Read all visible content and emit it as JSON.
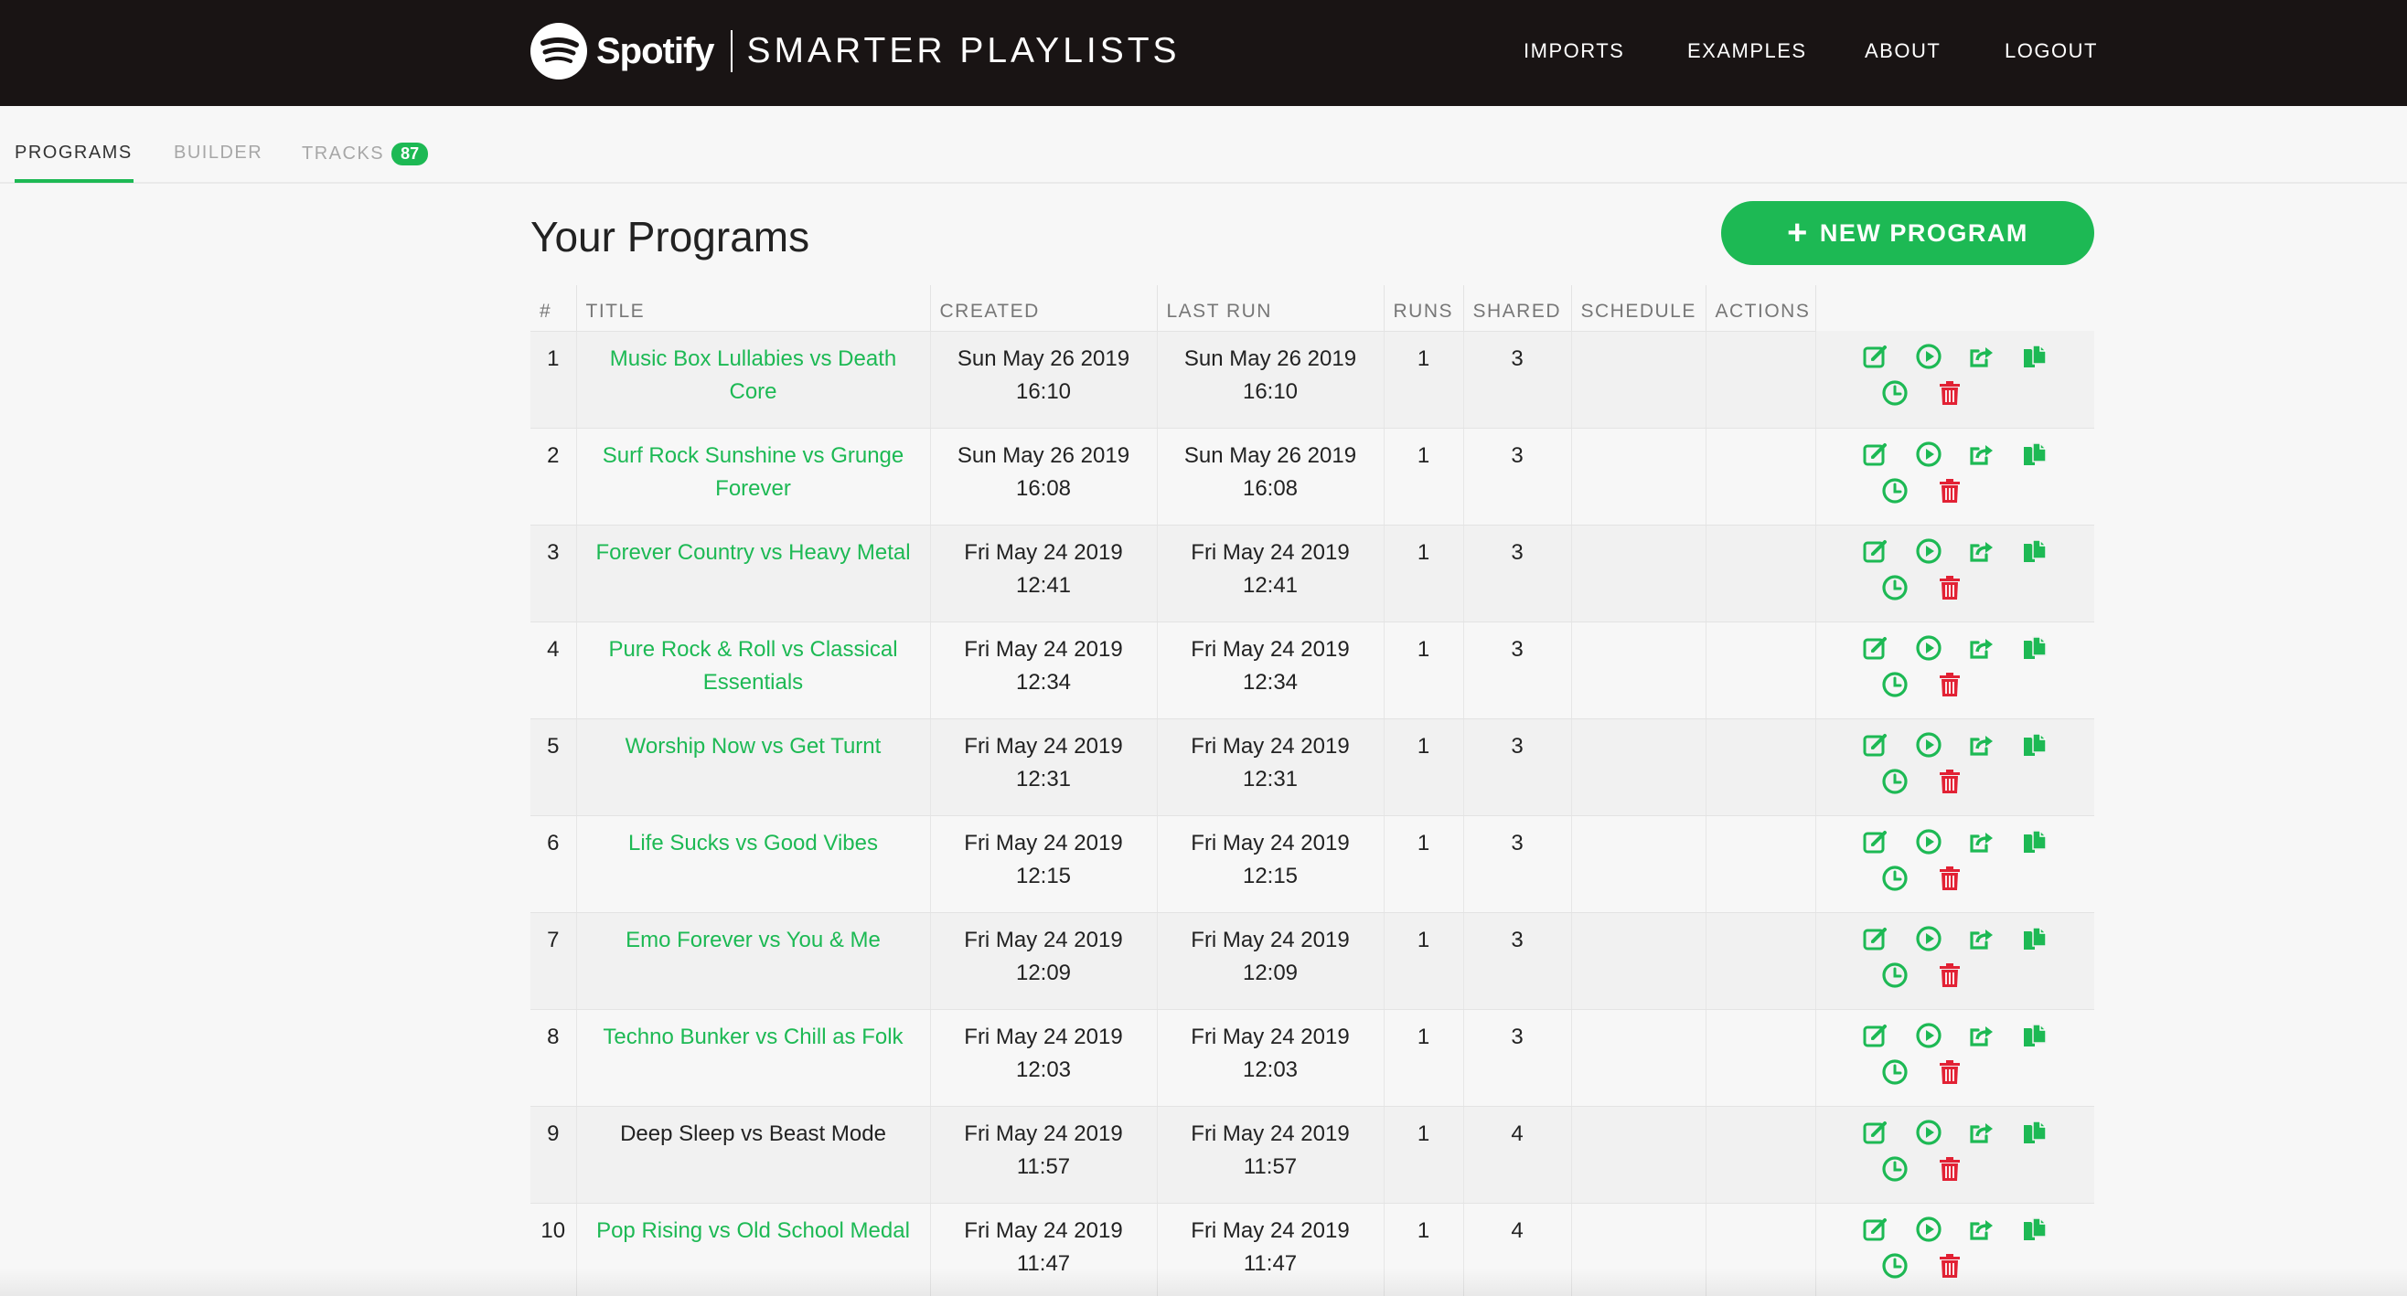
{
  "brand": {
    "spotify_wordmark": "Spotify",
    "subtitle": "SMARTER PLAYLISTS"
  },
  "nav": {
    "imports": "IMPORTS",
    "examples": "EXAMPLES",
    "about": "ABOUT",
    "logout": "LOGOUT"
  },
  "tabs": {
    "programs": "PROGRAMS",
    "builder": "BUILDER",
    "tracks": "TRACKS",
    "tracks_count": "87"
  },
  "main": {
    "title": "Your Programs",
    "new_program_label": "NEW PROGRAM",
    "new_program_icon": "plus-icon"
  },
  "table": {
    "headers": [
      "#",
      "TITLE",
      "CREATED",
      "LAST RUN",
      "RUNS",
      "SHARED",
      "SCHEDULE",
      "ACTIONS"
    ],
    "rows": [
      {
        "num": "1",
        "title": "Music Box Lullabies vs Death Core",
        "linked": true,
        "created_date": "Sun May 26 2019",
        "created_time": "16:10",
        "last_date": "Sun May 26 2019",
        "last_time": "16:10",
        "runs": "1",
        "shared": "3",
        "schedule": ""
      },
      {
        "num": "2",
        "title": "Surf Rock Sunshine vs Grunge Forever",
        "linked": true,
        "created_date": "Sun May 26 2019",
        "created_time": "16:08",
        "last_date": "Sun May 26 2019",
        "last_time": "16:08",
        "runs": "1",
        "shared": "3",
        "schedule": ""
      },
      {
        "num": "3",
        "title": "Forever Country vs Heavy Metal",
        "linked": true,
        "created_date": "Fri May 24 2019",
        "created_time": "12:41",
        "last_date": "Fri May 24 2019",
        "last_time": "12:41",
        "runs": "1",
        "shared": "3",
        "schedule": ""
      },
      {
        "num": "4",
        "title": "Pure Rock & Roll vs Classical Essentials",
        "linked": true,
        "created_date": "Fri May 24 2019",
        "created_time": "12:34",
        "last_date": "Fri May 24 2019",
        "last_time": "12:34",
        "runs": "1",
        "shared": "3",
        "schedule": ""
      },
      {
        "num": "5",
        "title": "Worship Now vs Get Turnt",
        "linked": true,
        "created_date": "Fri May 24 2019",
        "created_time": "12:31",
        "last_date": "Fri May 24 2019",
        "last_time": "12:31",
        "runs": "1",
        "shared": "3",
        "schedule": ""
      },
      {
        "num": "6",
        "title": "Life Sucks vs Good Vibes",
        "linked": true,
        "created_date": "Fri May 24 2019",
        "created_time": "12:15",
        "last_date": "Fri May 24 2019",
        "last_time": "12:15",
        "runs": "1",
        "shared": "3",
        "schedule": ""
      },
      {
        "num": "7",
        "title": "Emo Forever vs You & Me",
        "linked": true,
        "created_date": "Fri May 24 2019",
        "created_time": "12:09",
        "last_date": "Fri May 24 2019",
        "last_time": "12:09",
        "runs": "1",
        "shared": "3",
        "schedule": ""
      },
      {
        "num": "8",
        "title": "Techno Bunker vs Chill as Folk",
        "linked": true,
        "created_date": "Fri May 24 2019",
        "created_time": "12:03",
        "last_date": "Fri May 24 2019",
        "last_time": "12:03",
        "runs": "1",
        "shared": "3",
        "schedule": ""
      },
      {
        "num": "9",
        "title": "Deep Sleep vs Beast Mode",
        "linked": false,
        "created_date": "Fri May 24 2019",
        "created_time": "11:57",
        "last_date": "Fri May 24 2019",
        "last_time": "11:57",
        "runs": "1",
        "shared": "4",
        "schedule": ""
      },
      {
        "num": "10",
        "title": "Pop Rising vs Old School Medal",
        "linked": true,
        "created_date": "Fri May 24 2019",
        "created_time": "11:47",
        "last_date": "Fri May 24 2019",
        "last_time": "11:47",
        "runs": "1",
        "shared": "4",
        "schedule": ""
      }
    ],
    "action_icons": [
      "edit-icon",
      "play-icon",
      "share-icon",
      "copy-icon",
      "schedule-clock-icon",
      "delete-trash-icon"
    ]
  },
  "colors": {
    "accent": "#1db954",
    "danger": "#e22134",
    "navbar": "#191414",
    "background": "#f7f7f7"
  }
}
